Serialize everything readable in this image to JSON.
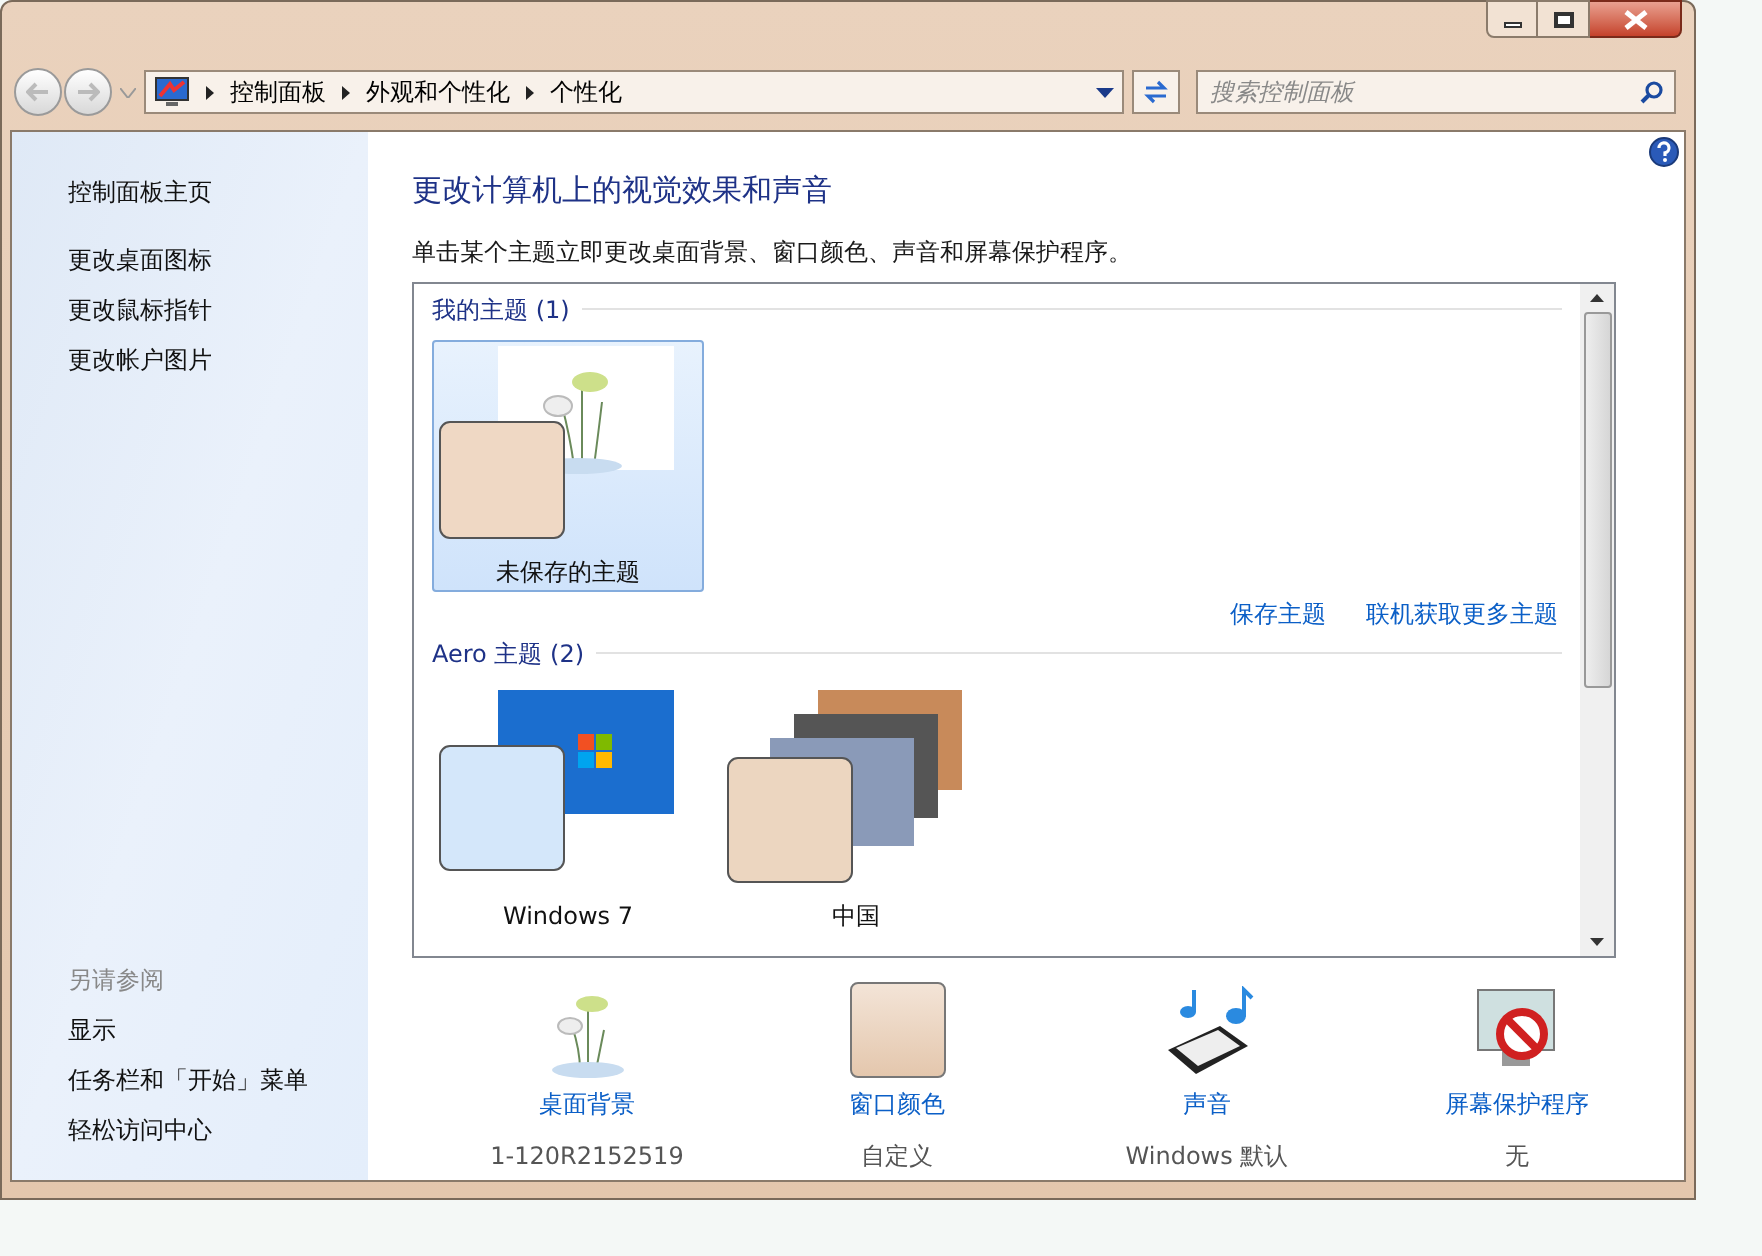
{
  "address_bar": {
    "breadcrumbs": [
      "控制面板",
      "外观和个性化",
      "个性化"
    ],
    "search": {
      "placeholder": "搜索控制面板"
    }
  },
  "sidebar": {
    "items": [
      "控制面板主页",
      "更改桌面图标",
      "更改鼠标指针",
      "更改帐户图片"
    ],
    "see_also": {
      "heading": "另请参阅",
      "items": [
        "显示",
        "任务栏和「开始」菜单",
        "轻松访问中心"
      ]
    }
  },
  "main": {
    "title": "更改计算机上的视觉效果和声音",
    "description": "单击某个主题立即更改桌面背景、窗口颜色、声音和屏幕保护程序。",
    "groups": [
      {
        "heading": "我的主题 (1)",
        "themes": [
          {
            "name": "未保存的主题",
            "kind": "flowers",
            "selected": true
          }
        ],
        "links": [
          "保存主题",
          "联机获取更多主题"
        ]
      },
      {
        "heading": "Aero 主题 (2)",
        "themes": [
          {
            "name": "Windows 7",
            "kind": "windows",
            "selected": false
          },
          {
            "name": "中国",
            "kind": "china",
            "selected": false
          }
        ]
      }
    ],
    "settings": [
      {
        "kind": "background",
        "label": "桌面背景",
        "value": "1-120R2152519"
      },
      {
        "kind": "color",
        "label": "窗口颜色",
        "value": "自定义"
      },
      {
        "kind": "sound",
        "label": "声音",
        "value": "Windows 默认"
      },
      {
        "kind": "screensaver",
        "label": "屏幕保护程序",
        "value": "无"
      }
    ]
  }
}
